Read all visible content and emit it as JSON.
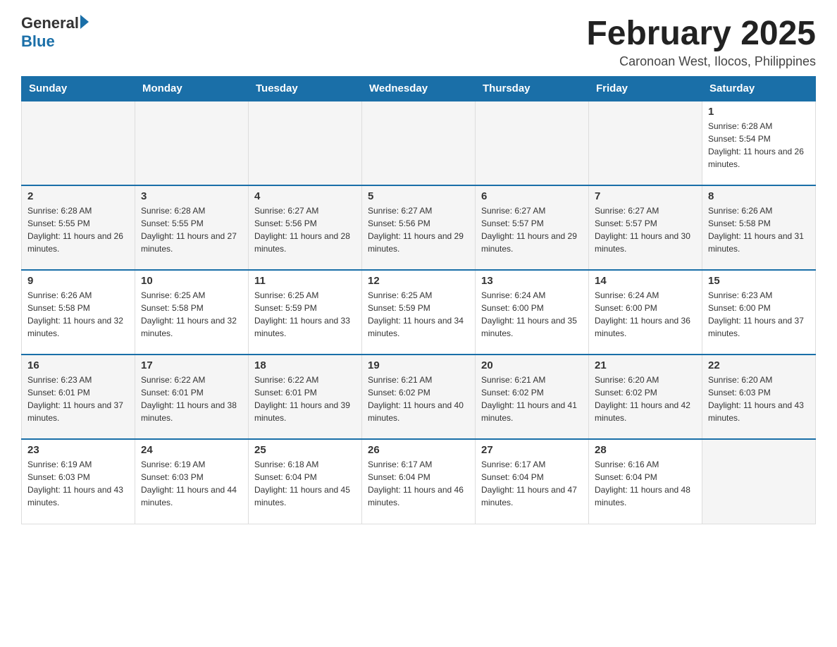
{
  "header": {
    "logo_general": "General",
    "logo_blue": "Blue",
    "title": "February 2025",
    "subtitle": "Caronoan West, Ilocos, Philippines"
  },
  "weekdays": [
    "Sunday",
    "Monday",
    "Tuesday",
    "Wednesday",
    "Thursday",
    "Friday",
    "Saturday"
  ],
  "weeks": [
    [
      {
        "day": "",
        "info": ""
      },
      {
        "day": "",
        "info": ""
      },
      {
        "day": "",
        "info": ""
      },
      {
        "day": "",
        "info": ""
      },
      {
        "day": "",
        "info": ""
      },
      {
        "day": "",
        "info": ""
      },
      {
        "day": "1",
        "info": "Sunrise: 6:28 AM\nSunset: 5:54 PM\nDaylight: 11 hours and 26 minutes."
      }
    ],
    [
      {
        "day": "2",
        "info": "Sunrise: 6:28 AM\nSunset: 5:55 PM\nDaylight: 11 hours and 26 minutes."
      },
      {
        "day": "3",
        "info": "Sunrise: 6:28 AM\nSunset: 5:55 PM\nDaylight: 11 hours and 27 minutes."
      },
      {
        "day": "4",
        "info": "Sunrise: 6:27 AM\nSunset: 5:56 PM\nDaylight: 11 hours and 28 minutes."
      },
      {
        "day": "5",
        "info": "Sunrise: 6:27 AM\nSunset: 5:56 PM\nDaylight: 11 hours and 29 minutes."
      },
      {
        "day": "6",
        "info": "Sunrise: 6:27 AM\nSunset: 5:57 PM\nDaylight: 11 hours and 29 minutes."
      },
      {
        "day": "7",
        "info": "Sunrise: 6:27 AM\nSunset: 5:57 PM\nDaylight: 11 hours and 30 minutes."
      },
      {
        "day": "8",
        "info": "Sunrise: 6:26 AM\nSunset: 5:58 PM\nDaylight: 11 hours and 31 minutes."
      }
    ],
    [
      {
        "day": "9",
        "info": "Sunrise: 6:26 AM\nSunset: 5:58 PM\nDaylight: 11 hours and 32 minutes."
      },
      {
        "day": "10",
        "info": "Sunrise: 6:25 AM\nSunset: 5:58 PM\nDaylight: 11 hours and 32 minutes."
      },
      {
        "day": "11",
        "info": "Sunrise: 6:25 AM\nSunset: 5:59 PM\nDaylight: 11 hours and 33 minutes."
      },
      {
        "day": "12",
        "info": "Sunrise: 6:25 AM\nSunset: 5:59 PM\nDaylight: 11 hours and 34 minutes."
      },
      {
        "day": "13",
        "info": "Sunrise: 6:24 AM\nSunset: 6:00 PM\nDaylight: 11 hours and 35 minutes."
      },
      {
        "day": "14",
        "info": "Sunrise: 6:24 AM\nSunset: 6:00 PM\nDaylight: 11 hours and 36 minutes."
      },
      {
        "day": "15",
        "info": "Sunrise: 6:23 AM\nSunset: 6:00 PM\nDaylight: 11 hours and 37 minutes."
      }
    ],
    [
      {
        "day": "16",
        "info": "Sunrise: 6:23 AM\nSunset: 6:01 PM\nDaylight: 11 hours and 37 minutes."
      },
      {
        "day": "17",
        "info": "Sunrise: 6:22 AM\nSunset: 6:01 PM\nDaylight: 11 hours and 38 minutes."
      },
      {
        "day": "18",
        "info": "Sunrise: 6:22 AM\nSunset: 6:01 PM\nDaylight: 11 hours and 39 minutes."
      },
      {
        "day": "19",
        "info": "Sunrise: 6:21 AM\nSunset: 6:02 PM\nDaylight: 11 hours and 40 minutes."
      },
      {
        "day": "20",
        "info": "Sunrise: 6:21 AM\nSunset: 6:02 PM\nDaylight: 11 hours and 41 minutes."
      },
      {
        "day": "21",
        "info": "Sunrise: 6:20 AM\nSunset: 6:02 PM\nDaylight: 11 hours and 42 minutes."
      },
      {
        "day": "22",
        "info": "Sunrise: 6:20 AM\nSunset: 6:03 PM\nDaylight: 11 hours and 43 minutes."
      }
    ],
    [
      {
        "day": "23",
        "info": "Sunrise: 6:19 AM\nSunset: 6:03 PM\nDaylight: 11 hours and 43 minutes."
      },
      {
        "day": "24",
        "info": "Sunrise: 6:19 AM\nSunset: 6:03 PM\nDaylight: 11 hours and 44 minutes."
      },
      {
        "day": "25",
        "info": "Sunrise: 6:18 AM\nSunset: 6:04 PM\nDaylight: 11 hours and 45 minutes."
      },
      {
        "day": "26",
        "info": "Sunrise: 6:17 AM\nSunset: 6:04 PM\nDaylight: 11 hours and 46 minutes."
      },
      {
        "day": "27",
        "info": "Sunrise: 6:17 AM\nSunset: 6:04 PM\nDaylight: 11 hours and 47 minutes."
      },
      {
        "day": "28",
        "info": "Sunrise: 6:16 AM\nSunset: 6:04 PM\nDaylight: 11 hours and 48 minutes."
      },
      {
        "day": "",
        "info": ""
      }
    ]
  ]
}
